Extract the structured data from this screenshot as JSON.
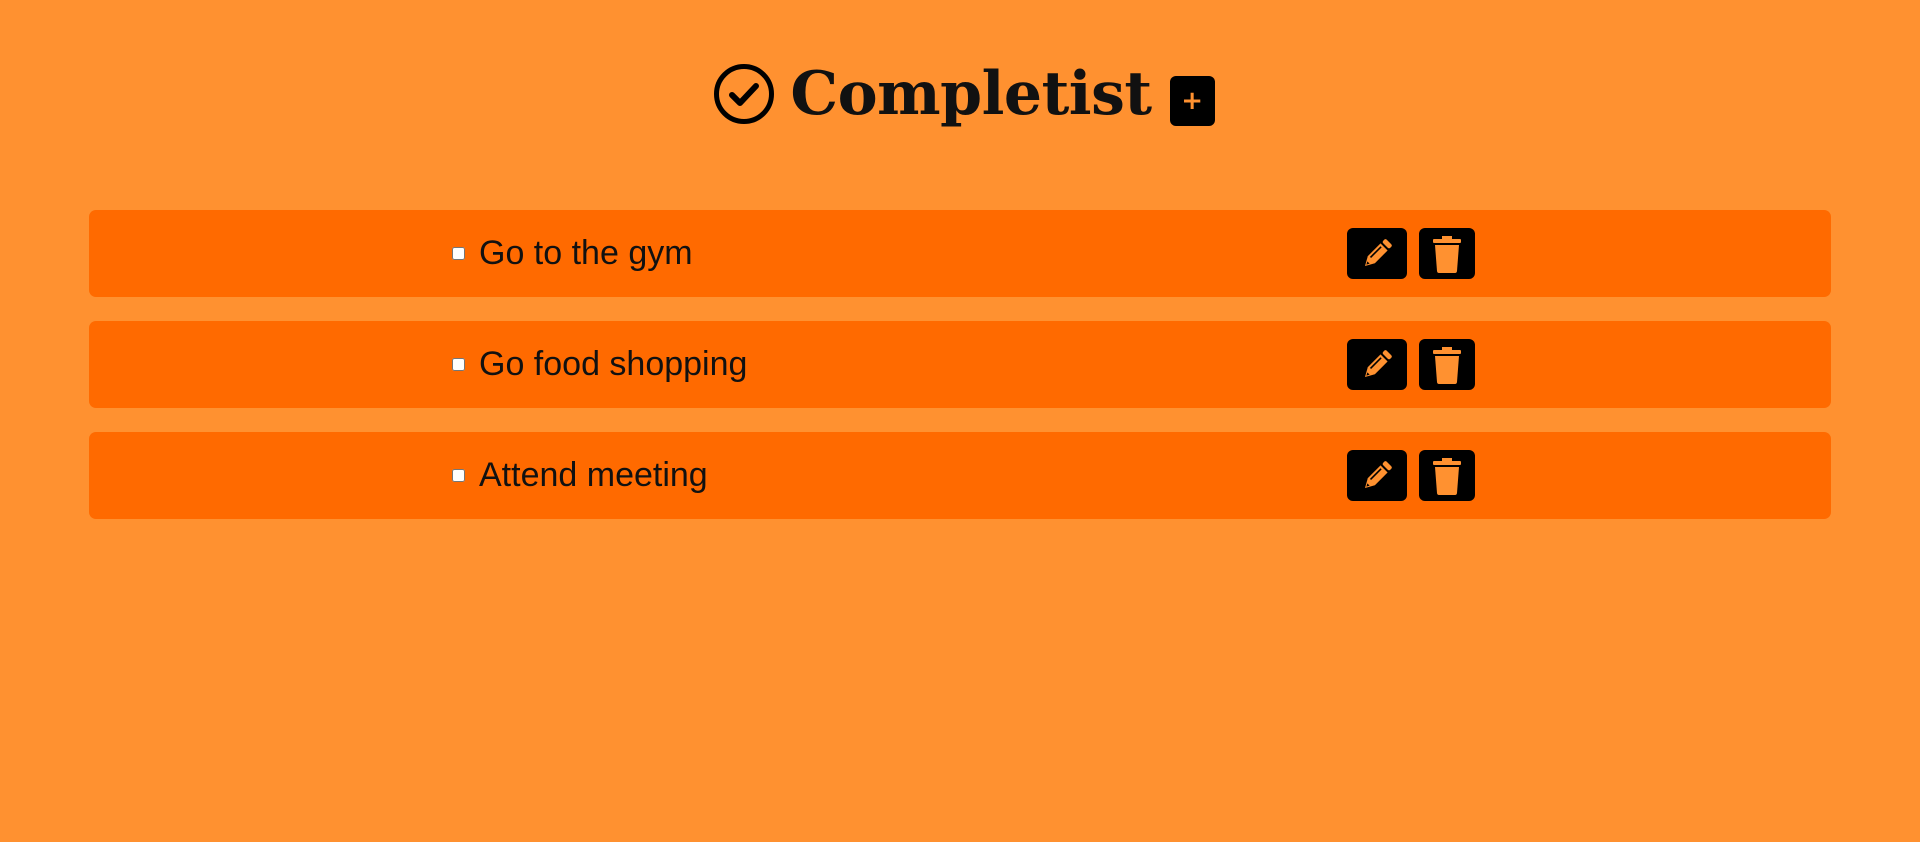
{
  "app": {
    "title": "Completist",
    "logo_icon": "check-circle-icon",
    "add_button_label": "+"
  },
  "colors": {
    "background": "#ff9130",
    "row_background": "#ff6a00",
    "button_background": "#000000",
    "icon_color": "#ff9130",
    "text": "#111111"
  },
  "tasks": [
    {
      "label": "Go to the gym",
      "checked": false,
      "edit_icon": "pencil-icon",
      "delete_icon": "trash-icon"
    },
    {
      "label": "Go food shopping",
      "checked": false,
      "edit_icon": "pencil-icon",
      "delete_icon": "trash-icon"
    },
    {
      "label": "Attend meeting",
      "checked": false,
      "edit_icon": "pencil-icon",
      "delete_icon": "trash-icon"
    }
  ]
}
